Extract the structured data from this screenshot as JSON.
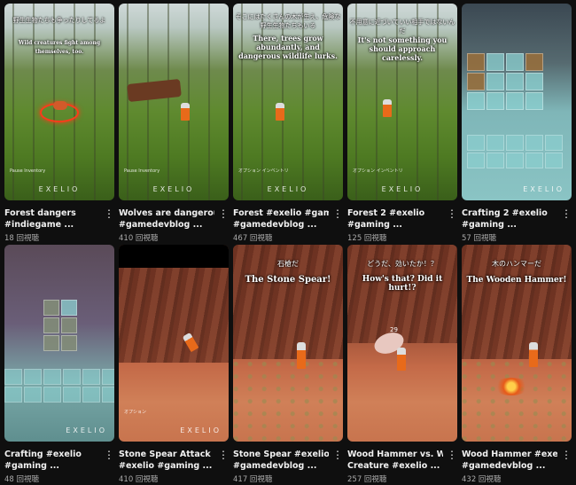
{
  "videos": [
    {
      "title_line1": "Forest dangers",
      "title_line2": "#indiegame ...",
      "views": "18 回視聴",
      "caption_jp": "野生生物たちも争ったりしてるよ",
      "caption_en": "Wild creatures fight among themselves, too.",
      "hud": "Pause  Inventory",
      "logo": "EXELIO"
    },
    {
      "title_line1": "Wolves are  dangerous.",
      "title_line2": "#gamedevblog ...",
      "views": "410 回視聴",
      "hud": "Pause  Inventory",
      "logo": "EXELIO"
    },
    {
      "title_line1": "Forest  #exelio #gaming",
      "title_line2": "#gamedevblog ...",
      "views": "467 回視聴",
      "caption_jp": "そこにはたくさんの木が生え、危険な野生生物たちもいる",
      "caption_en": "There, trees grow abundantly, and dangerous wildlife lurks.",
      "hud": "オプション  インベントリ",
      "logo": "EXELIO"
    },
    {
      "title_line1": "Forest 2  #exelio",
      "title_line2": "#gaming ...",
      "views": "125 回視聴",
      "caption_jp": "不用意に近づいていい相手ではないんだ",
      "caption_en": "It's not something you should approach carelessly.",
      "hud": "オプション  インベントリ",
      "logo": "EXELIO"
    },
    {
      "title_line1": "Crafting 2  #exelio",
      "title_line2": "#gaming ...",
      "views": "57 回視聴",
      "logo": "EXELIO"
    },
    {
      "title_line1": "Crafting  #exelio",
      "title_line2": "#gaming ...",
      "views": "48 回視聴",
      "logo": "EXELIO"
    },
    {
      "title_line1": "Stone Spear Attack",
      "title_line2": "#exelio #gaming ...",
      "views": "410 回視聴",
      "hud": "オプション",
      "logo": "EXELIO"
    },
    {
      "title_line1": "Stone Spear #exelio",
      "title_line2": "#gamedevblog ...",
      "views": "417 回視聴",
      "caption_jp": "石槍だ",
      "caption_en": "The Stone Spear!"
    },
    {
      "title_line1": "Wood Hammer vs. Wild",
      "title_line2": "Creature  #exelio ...",
      "views": "257 回視聴",
      "caption_jp": "どうだ、効いたか！？",
      "caption_en": "How's that? Did it hurt!?",
      "hit_number": "29"
    },
    {
      "title_line1": "Wood Hammer  #exelio",
      "title_line2": "#gamedevblog ...",
      "views": "432 回視聴",
      "caption_jp": "木のハンマーだ",
      "caption_en": "The Wooden Hammer!"
    }
  ],
  "menu_icon": "more-vert-icon",
  "menu_glyph": "⋮"
}
